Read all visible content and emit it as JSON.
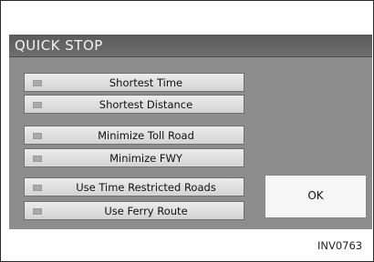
{
  "dialog": {
    "title": "QUICK STOP",
    "options": [
      {
        "label": "Shortest Time"
      },
      {
        "label": "Shortest Distance"
      },
      {
        "label": "Minimize Toll Road"
      },
      {
        "label": "Minimize FWY"
      },
      {
        "label": "Use Time Restricted Roads"
      },
      {
        "label": "Use Ferry Route"
      }
    ],
    "ok_label": "OK"
  },
  "figure_code": "INV0763"
}
